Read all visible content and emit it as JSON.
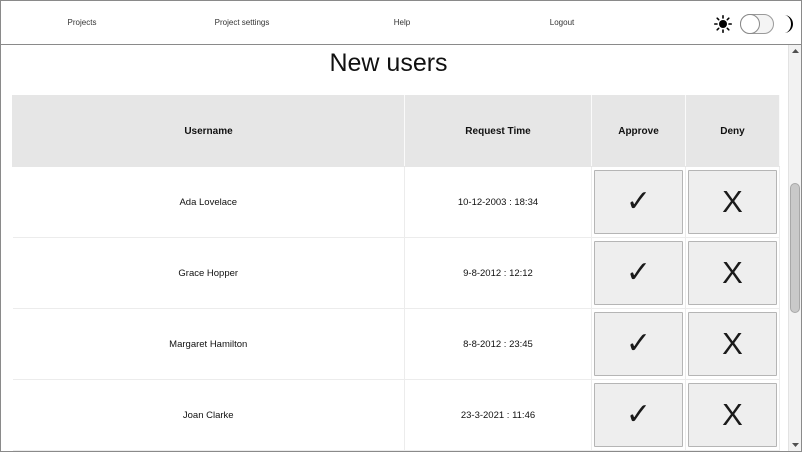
{
  "navbar": {
    "links": [
      {
        "label": "Projects"
      },
      {
        "label": "Project settings"
      },
      {
        "label": "Help"
      },
      {
        "label": "Logout"
      }
    ],
    "theme": {
      "mode": "light",
      "sun_icon": "sun-icon",
      "moon_icon": "moon-icon"
    }
  },
  "page": {
    "title": "New users"
  },
  "table": {
    "headers": [
      "Username",
      "Request Time",
      "Approve",
      "Deny"
    ],
    "rows": [
      {
        "username": "Ada Lovelace",
        "request_time": "10-12-2003 : 18:34",
        "approve": "✓",
        "deny": "X"
      },
      {
        "username": "Grace Hopper",
        "request_time": "9-8-2012 : 12:12",
        "approve": "✓",
        "deny": "X"
      },
      {
        "username": "Margaret Hamilton",
        "request_time": "8-8-2012 : 23:45",
        "approve": "✓",
        "deny": "X"
      },
      {
        "username": "Joan Clarke",
        "request_time": "23-3-2021 : 11:46",
        "approve": "✓",
        "deny": "X"
      }
    ]
  },
  "colors": {
    "header_bg": "#e6e6e6",
    "button_bg": "#eeeeee",
    "border": "#8a8a8a"
  }
}
